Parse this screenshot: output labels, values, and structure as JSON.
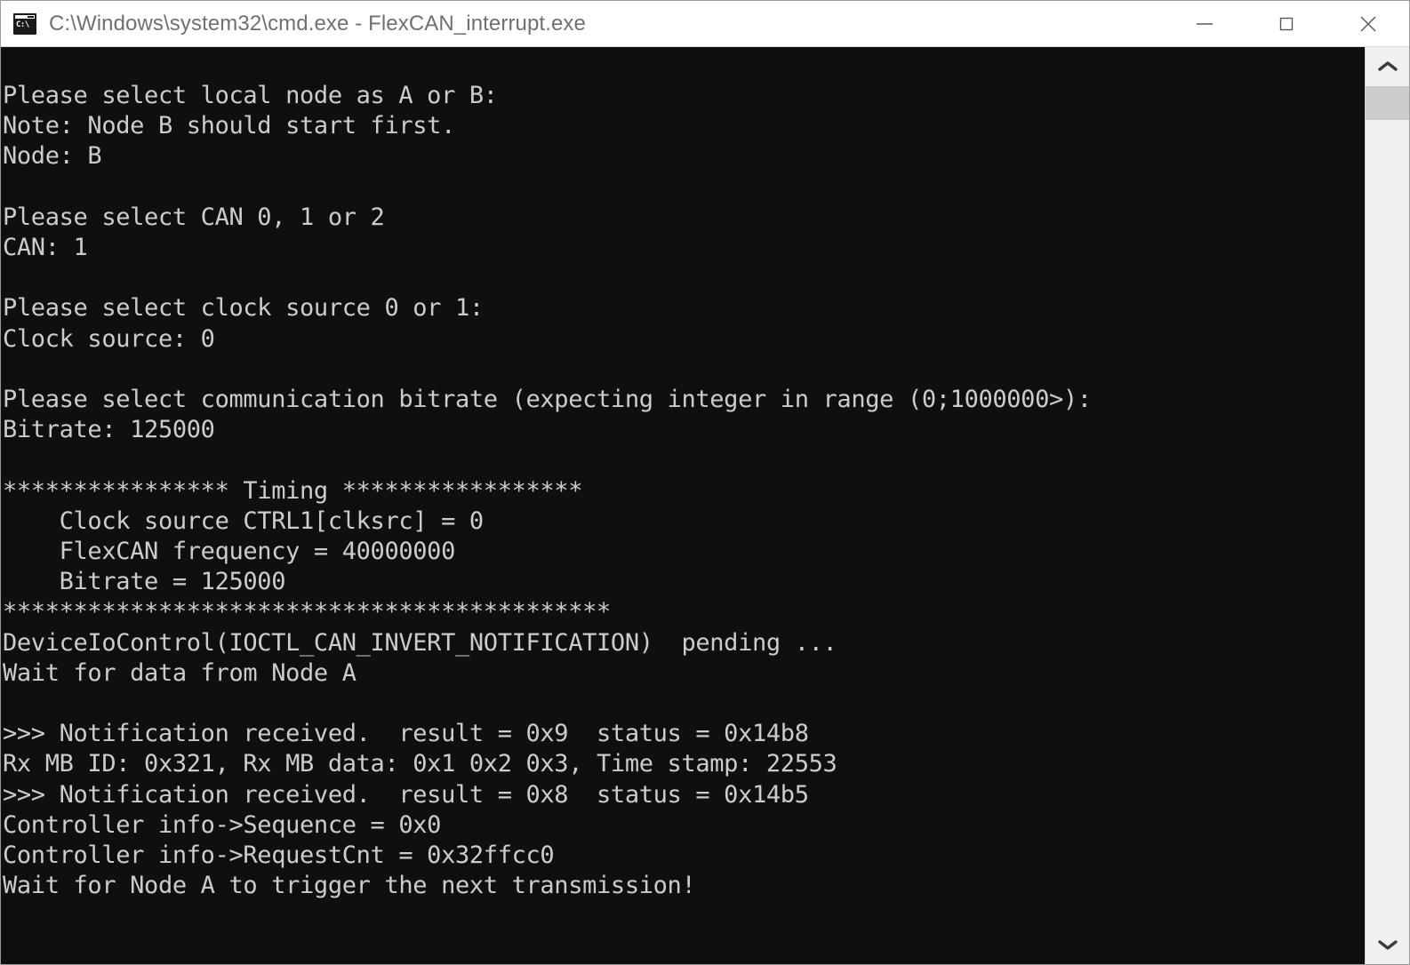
{
  "window": {
    "title": "C:\\Windows\\system32\\cmd.exe - FlexCAN_interrupt.exe",
    "icon_name": "cmd-console-icon",
    "icon_glyph": "C:\\",
    "background_color": "#0f0f0f",
    "text_color": "#cccccc",
    "titlebar_color": "#ffffff",
    "titlebar_text_color": "#707070",
    "controls": {
      "minimize_label": "Minimize",
      "maximize_label": "Maximize",
      "close_label": "Close"
    }
  },
  "scrollbar": {
    "up_arrow_label": "Scroll up",
    "down_arrow_label": "Scroll down",
    "thumb_label": "Scroll thumb"
  },
  "console": {
    "prompts": {
      "node_prompt": "Please select local node as A or B:",
      "node_note": "Note: Node B should start first.",
      "node_value": "Node: B",
      "can_prompt": "Please select CAN 0, 1 or 2",
      "can_value": "CAN: 1",
      "clock_prompt": "Please select clock source 0 or 1:",
      "clock_value": "Clock source: 0",
      "bitrate_prompt": "Please select communication bitrate (expecting integer in range (0;1000000>):",
      "bitrate_value": "Bitrate: 125000"
    },
    "timing": {
      "header": "**************** Timing *****************",
      "clock_source": "    Clock source CTRL1[clksrc] = 0",
      "flexcan_frequency": "    FlexCAN frequency = 40000000",
      "bitrate": "    Bitrate = 125000",
      "footer": "*******************************************"
    },
    "ioctl": {
      "device_io_control": "DeviceIoControl(IOCTL_CAN_INVERT_NOTIFICATION)  pending ...",
      "wait_for_data": "Wait for data from Node A"
    },
    "notifications": {
      "notification_1": ">>> Notification received.  result = 0x9  status = 0x14b8",
      "rx_mb_line": "Rx MB ID: 0x321, Rx MB data: 0x1 0x2 0x3, Time stamp: 22553",
      "notification_2": ">>> Notification received.  result = 0x8  status = 0x14b5",
      "sequence": "Controller info->Sequence = 0x0",
      "request_cnt": "Controller info->RequestCnt = 0x32ffcc0",
      "wait_trigger": "Wait for Node A to trigger the next transmission!"
    },
    "full_text": "Please select local node as A or B:\nNote: Node B should start first.\nNode: B\n\nPlease select CAN 0, 1 or 2\nCAN: 1\n\nPlease select clock source 0 or 1:\nClock source: 0\n\nPlease select communication bitrate (expecting integer in range (0;1000000>):\nBitrate: 125000\n\n**************** Timing *****************\n    Clock source CTRL1[clksrc] = 0\n    FlexCAN frequency = 40000000\n    Bitrate = 125000\n*******************************************\nDeviceIoControl(IOCTL_CAN_INVERT_NOTIFICATION)  pending ...\nWait for data from Node A\n\n>>> Notification received.  result = 0x9  status = 0x14b8\nRx MB ID: 0x321, Rx MB data: 0x1 0x2 0x3, Time stamp: 22553\n>>> Notification received.  result = 0x8  status = 0x14b5\nController info->Sequence = 0x0\nController info->RequestCnt = 0x32ffcc0\nWait for Node A to trigger the next transmission!"
  }
}
